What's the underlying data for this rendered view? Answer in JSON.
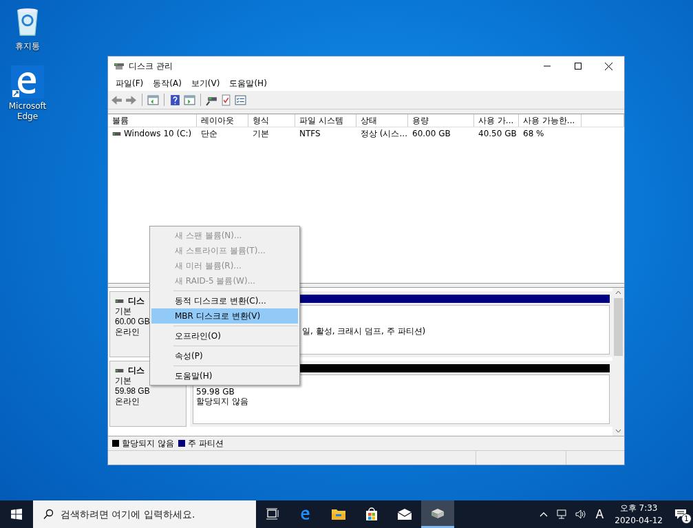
{
  "desktop_icons": [
    {
      "kind": "recycle",
      "label": "휴지통"
    },
    {
      "kind": "edge",
      "label": "Microsoft Edge"
    }
  ],
  "window": {
    "title": "디스크 관리"
  },
  "menu": [
    {
      "label": "파일(F)"
    },
    {
      "label": "동작(A)"
    },
    {
      "label": "보기(V)"
    },
    {
      "label": "도움말(H)"
    }
  ],
  "volume_table": {
    "columns": [
      "볼륨",
      "레이아웃",
      "형식",
      "파일 시스템",
      "상태",
      "용량",
      "사용 가...",
      "사용 가능한..."
    ],
    "rows": [
      [
        "Windows 10 (C:)",
        "단순",
        "기본",
        "NTFS",
        "정상 (시스...",
        "60.00 GB",
        "40.50 GB",
        "68 %"
      ]
    ]
  },
  "disks": [
    {
      "label": "디스",
      "type": "기본",
      "size": "60.00 GB",
      "status": "온라인",
      "color": "#000080",
      "partition_lines": [
        "일, 활성, 크래시 덤프, 주 파티션)"
      ]
    },
    {
      "label": "디스",
      "type": "기본",
      "size": "59.98 GB",
      "status": "온라인",
      "color": "#000000",
      "partition_lines": [
        "59.98 GB",
        "할당되지 않음"
      ]
    }
  ],
  "legend": [
    {
      "label": "할당되지 않음",
      "color": "#000000"
    },
    {
      "label": "주 파티션",
      "color": "#000080"
    }
  ],
  "context_menu": [
    {
      "kind": "item",
      "label": "새 스팬 볼륨(N)...",
      "disabled": true,
      "selected": false
    },
    {
      "kind": "item",
      "label": "새 스트라이프 볼륨(T)...",
      "disabled": true,
      "selected": false
    },
    {
      "kind": "item",
      "label": "새 미러 볼륨(R)...",
      "disabled": true,
      "selected": false
    },
    {
      "kind": "item",
      "label": "새 RAID-5 볼륨(W)...",
      "disabled": true,
      "selected": false
    },
    {
      "kind": "separator"
    },
    {
      "kind": "item",
      "label": "동적 디스크로 변환(C)...",
      "disabled": false,
      "selected": false
    },
    {
      "kind": "item",
      "label": "MBR 디스크로 변환(V)",
      "disabled": false,
      "selected": true
    },
    {
      "kind": "separator"
    },
    {
      "kind": "item",
      "label": "오프라인(O)",
      "disabled": false,
      "selected": false
    },
    {
      "kind": "separator"
    },
    {
      "kind": "item",
      "label": "속성(P)",
      "disabled": false,
      "selected": false
    },
    {
      "kind": "separator"
    },
    {
      "kind": "item",
      "label": "도움말(H)",
      "disabled": false,
      "selected": false
    }
  ],
  "taskbar": {
    "search": {
      "placeholder": "검색하려면 여기에 입력하세요."
    },
    "apps": [
      {
        "kind": "taskview",
        "active": false
      },
      {
        "kind": "edge",
        "active": false
      },
      {
        "kind": "explorer",
        "active": false
      },
      {
        "kind": "store",
        "active": false
      },
      {
        "kind": "mail",
        "active": false
      },
      {
        "kind": "disk",
        "active": true
      }
    ],
    "input_indicator": "A",
    "time": "오후 7:33",
    "date": "2020-04-12",
    "notification_count": "1"
  }
}
